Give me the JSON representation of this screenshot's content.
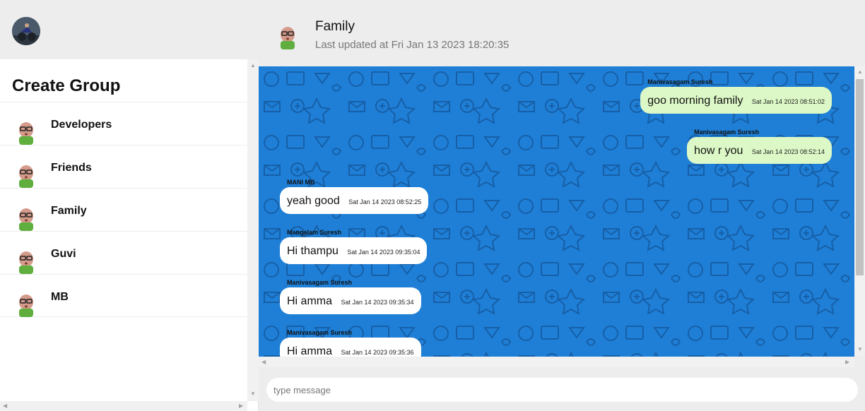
{
  "sidebar": {
    "create_group_label": "Create Group",
    "groups": [
      {
        "name": "Developers"
      },
      {
        "name": "Friends"
      },
      {
        "name": "Family"
      },
      {
        "name": "Guvi"
      },
      {
        "name": "MB"
      }
    ]
  },
  "chat": {
    "title": "Family",
    "updated": "Last updated at Fri Jan 13 2023 18:20:35",
    "messages": [
      {
        "author": "Manivasagam Suresh",
        "text": "goo morning family",
        "time": "Sat Jan 14 2023 08:51:02",
        "direction": "out"
      },
      {
        "author": "Manivasagam Suresh",
        "text": "how r you",
        "time": "Sat Jan 14 2023 08:52:14",
        "direction": "out"
      },
      {
        "author": "MANI MB",
        "text": "yeah good",
        "time": "Sat Jan 14 2023 08:52:25",
        "direction": "in"
      },
      {
        "author": "Mangalam Suresh",
        "text": "Hi thampu",
        "time": "Sat Jan 14 2023 09:35:04",
        "direction": "in"
      },
      {
        "author": "Manivasagam Suresh",
        "text": "Hi amma",
        "time": "Sat Jan 14 2023 09:35:34",
        "direction": "in"
      },
      {
        "author": "Manivasagam Suresh",
        "text": "Hi amma",
        "time": "Sat Jan 14 2023 09:35:36",
        "direction": "in"
      }
    ]
  },
  "composer": {
    "placeholder": "type message"
  },
  "colors": {
    "chat_background": "#1f7fd6",
    "outgoing_bubble": "#dcf8c6",
    "incoming_bubble": "#ffffff",
    "header": "#ededed"
  }
}
